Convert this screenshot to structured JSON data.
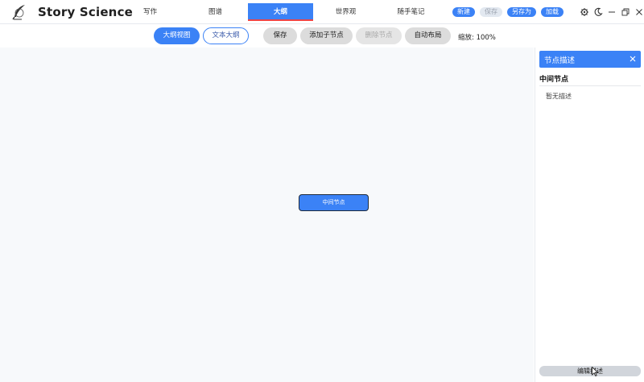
{
  "app": {
    "title": "Story Science",
    "logo_icon": "quill-feather-icon"
  },
  "tabs": [
    {
      "label": "写作",
      "active": false
    },
    {
      "label": "图谱",
      "active": false
    },
    {
      "label": "大纲",
      "active": true
    },
    {
      "label": "世界观",
      "active": false
    },
    {
      "label": "随手笔记",
      "active": false
    }
  ],
  "header_actions": {
    "new_label": "新建",
    "save_label": "保存",
    "save_as_label": "另存为",
    "load_label": "加载"
  },
  "window_icons": [
    "gear-icon",
    "moon-icon",
    "minimize-icon",
    "restore-icon",
    "close-icon"
  ],
  "toolbar": {
    "outline_view_label": "大纲视图",
    "text_outline_label": "文本大纲",
    "save_label": "保存",
    "add_child_label": "添加子节点",
    "delete_node_label": "删除节点",
    "auto_layout_label": "自动布局",
    "zoom_text": "缩放: 100%"
  },
  "canvas": {
    "node_label": "中间节点"
  },
  "panel": {
    "header_title": "节点描述",
    "node_title": "中间节点",
    "description": "暂无描述",
    "edit_label": "编辑描述"
  },
  "colors": {
    "accent": "#3b82f6",
    "active_tab_underline": "#ef4444",
    "canvas_bg": "#f7f9fb"
  }
}
